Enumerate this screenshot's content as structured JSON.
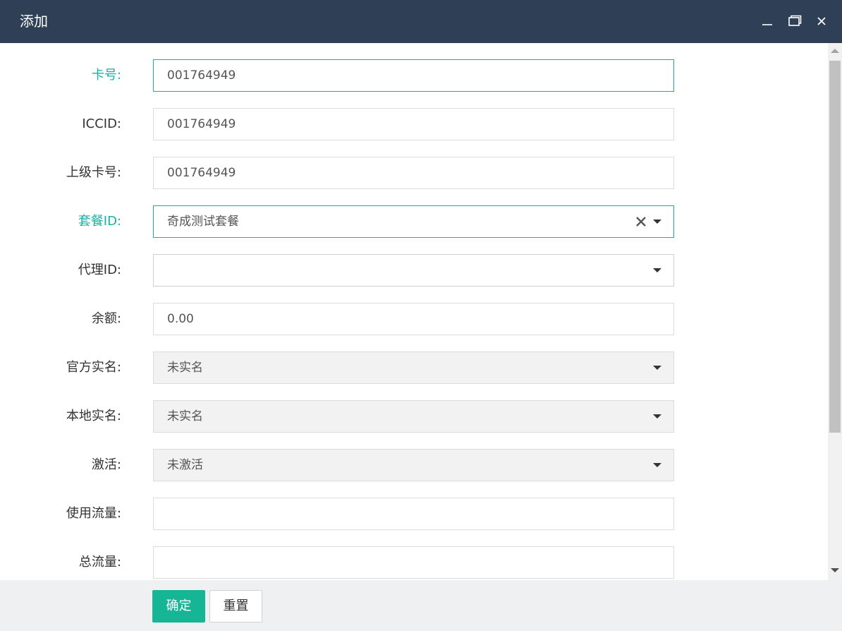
{
  "window": {
    "title": "添加",
    "controls": [
      "minimize-icon",
      "maximize-icon",
      "close-icon"
    ]
  },
  "form": {
    "card_no": {
      "label": "卡号:",
      "value": "001764949"
    },
    "iccid": {
      "label": "ICCID:",
      "value": "001764949"
    },
    "parent_card_no": {
      "label": "上级卡号:",
      "value": "001764949"
    },
    "package_id": {
      "label": "套餐ID:",
      "value": "奇成测试套餐"
    },
    "agent_id": {
      "label": "代理ID:",
      "value": ""
    },
    "balance": {
      "label": "余额:",
      "value": "0.00"
    },
    "official_realname": {
      "label": "官方实名:",
      "value": "未实名"
    },
    "local_realname": {
      "label": "本地实名:",
      "value": "未实名"
    },
    "activation": {
      "label": "激活:",
      "value": "未激活"
    },
    "used_traffic": {
      "label": "使用流量:",
      "value": ""
    },
    "total_traffic": {
      "label": "总流量:",
      "value": ""
    }
  },
  "footer": {
    "confirm_label": "确定",
    "reset_label": "重置"
  },
  "colors": {
    "titlebar": "#2f4056",
    "accent": "#16b1a0",
    "primary_button": "#16b595"
  }
}
